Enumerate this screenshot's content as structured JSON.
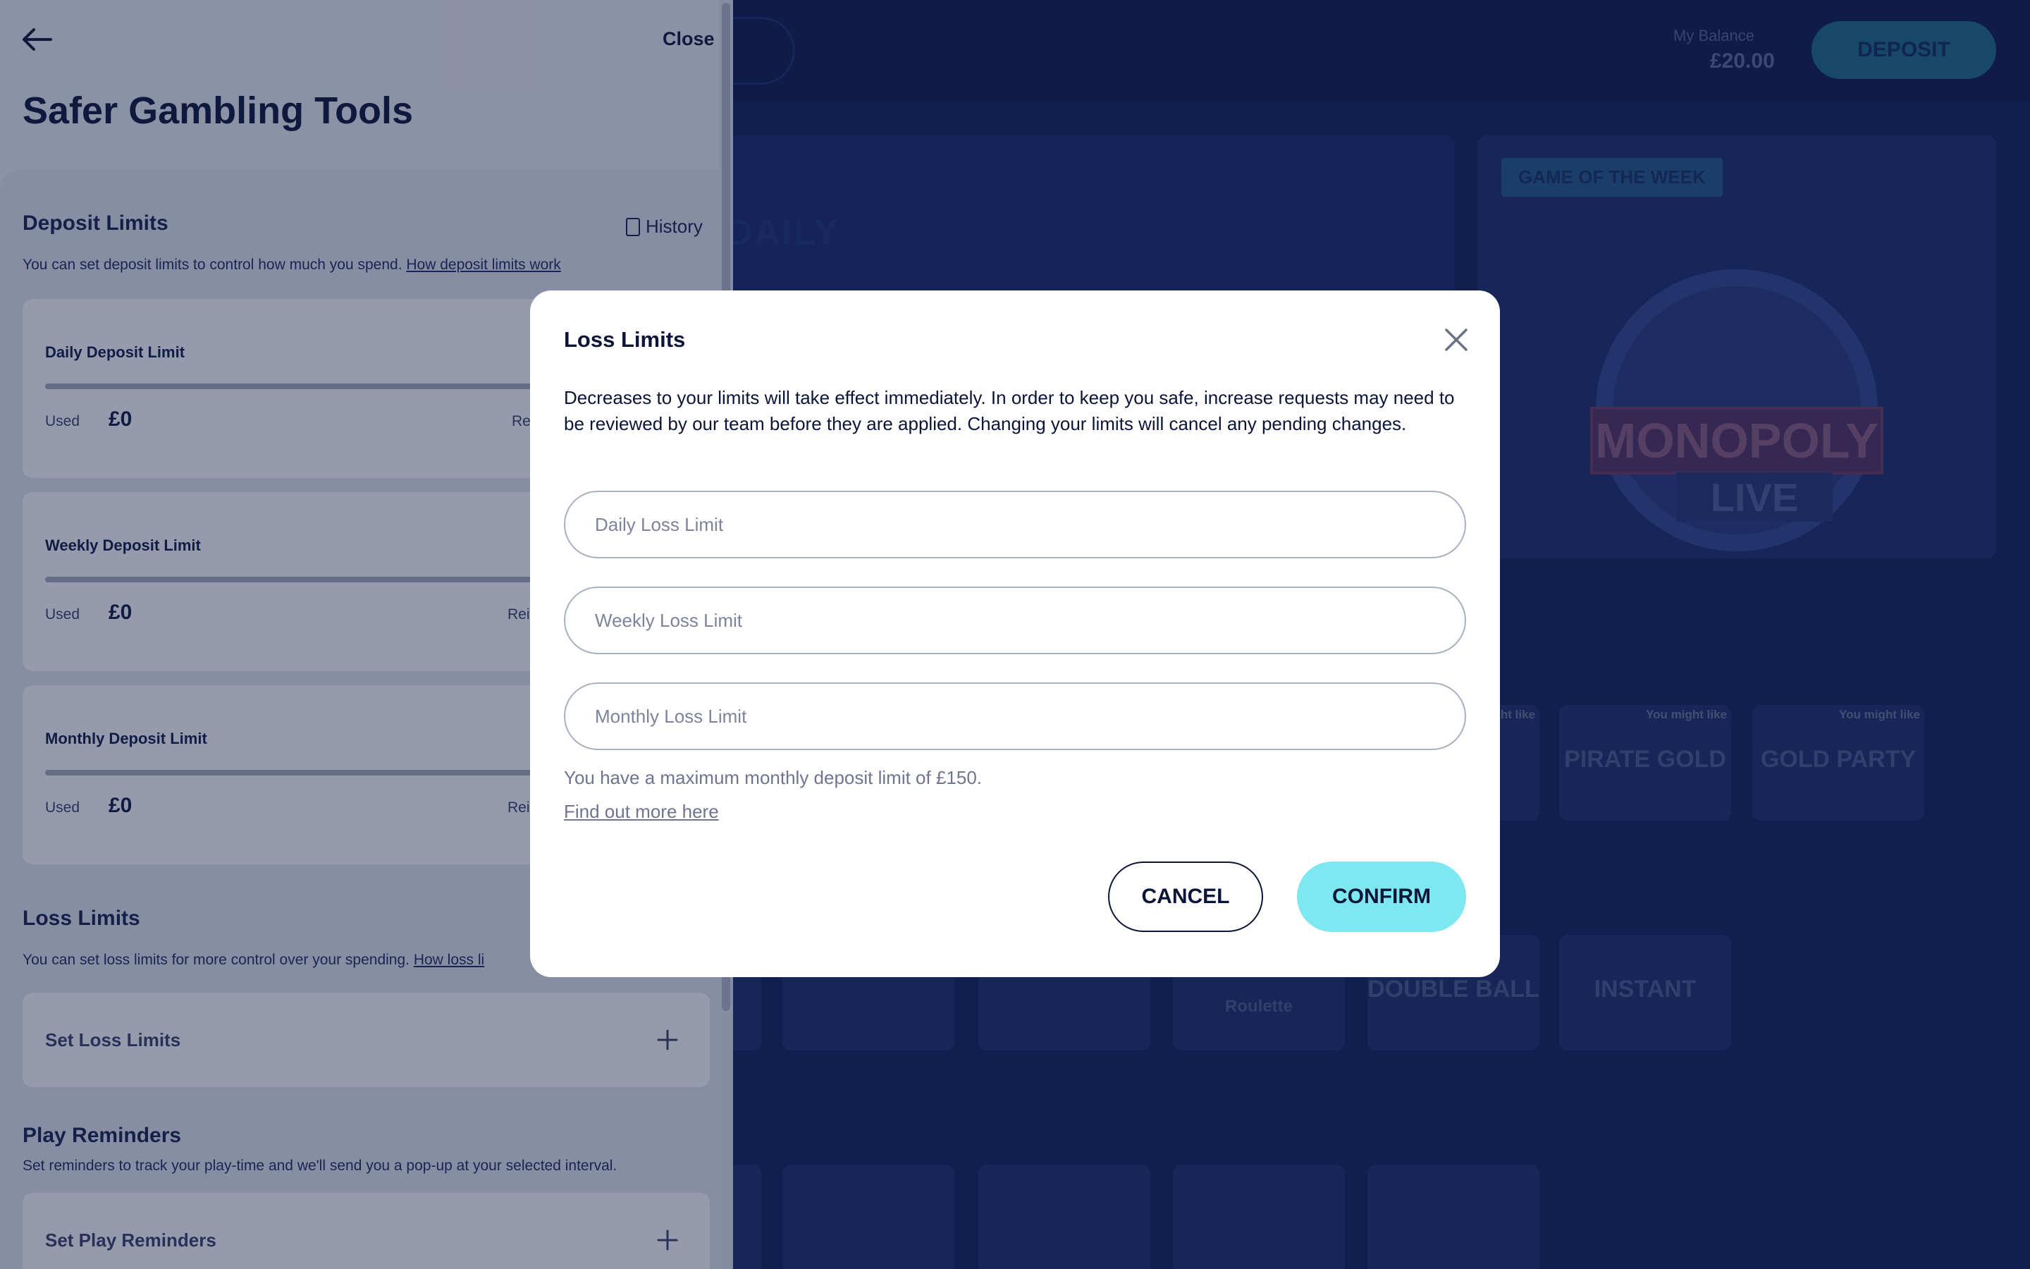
{
  "background": {
    "balance_label": "My Balance",
    "balance_value": "£20.00",
    "deposit_label": "DEPOSIT",
    "banner_text": "DAILY",
    "game_of_week_badge": "GAME OF THE WEEK",
    "game_of_week_title": "MONOPOLY",
    "game_of_week_subtitle": "LIVE",
    "tiles": [
      {
        "tag": "You might like",
        "text": ""
      },
      {
        "tag": "You might like",
        "text": "PIRATE GOLD"
      },
      {
        "tag": "You might like",
        "text": "GOLD PARTY"
      },
      {
        "tag": "",
        "text": "Roulette"
      },
      {
        "tag": "",
        "text": "DOUBLE BALL"
      },
      {
        "tag": "",
        "text": "INSTANT"
      }
    ]
  },
  "drawer": {
    "close_label": "Close",
    "title": "Safer Gambling Tools",
    "deposit_limits": {
      "title": "Deposit Limits",
      "history_label": "History",
      "description": "You can set deposit limits to control how much you spend.",
      "link": "How deposit limits work",
      "cards": [
        {
          "title": "Daily Deposit Limit",
          "used_label": "Used",
          "used_value": "£0",
          "remaining_label": "Re"
        },
        {
          "title": "Weekly Deposit Limit",
          "used_label": "Used",
          "used_value": "£0",
          "remaining_label": "Rei"
        },
        {
          "title": "Monthly Deposit Limit",
          "used_label": "Used",
          "used_value": "£0",
          "remaining_label": "Rei"
        }
      ]
    },
    "loss_limits": {
      "title": "Loss Limits",
      "description": "You can set loss limits for more control over your spending.",
      "link": "How loss li",
      "accordion_label": "Set Loss Limits"
    },
    "play_reminders": {
      "title": "Play Reminders",
      "description": "Set reminders to track your play-time and we'll send you a pop-up at your selected interval.",
      "accordion_label": "Set Play Reminders"
    }
  },
  "modal": {
    "title": "Loss Limits",
    "description": "Decreases to your limits will take effect immediately. In order to keep you safe, increase requests may need to be reviewed by our team before they are applied. Changing your limits will cancel any pending changes.",
    "inputs": [
      {
        "placeholder": "Daily Loss Limit",
        "value": ""
      },
      {
        "placeholder": "Weekly Loss Limit",
        "value": ""
      },
      {
        "placeholder": "Monthly Loss Limit",
        "value": ""
      }
    ],
    "note": "You have a maximum monthly deposit limit of £150.",
    "link": "Find out more here",
    "cancel_label": "CANCEL",
    "confirm_label": "CONFIRM"
  },
  "colors": {
    "page_bg": "#0d1f57",
    "confirm_accent": "#7ee8f0",
    "text_dark": "#0b1537"
  }
}
